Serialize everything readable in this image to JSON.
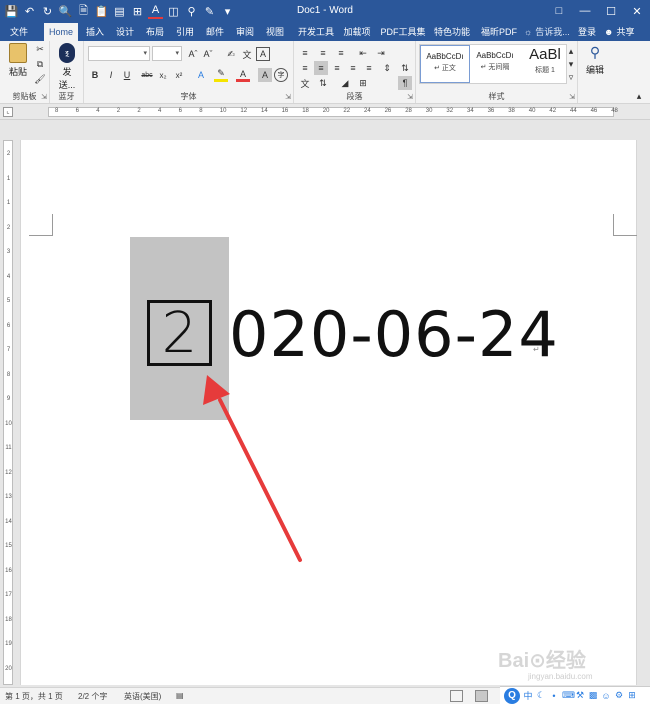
{
  "window": {
    "title": "Doc1 - Word",
    "controls": [
      "□",
      "—",
      "☐",
      "✕"
    ]
  },
  "qat": [
    "save-icon",
    "undo-icon",
    "redo-icon",
    "print-preview-icon",
    "new-icon",
    "paste-icon",
    "paragraph-icon",
    "insert-icon",
    "font-color-icon",
    "columns-icon",
    "find-icon",
    "touch-icon",
    "customize-icon"
  ],
  "tabs": [
    "文件",
    "Home",
    "插入",
    "设计",
    "布局",
    "引用",
    "邮件",
    "审阅",
    "视图",
    "开发工具",
    "加载项",
    "PDF工具集",
    "特色功能",
    "福昕PDF"
  ],
  "tell_me": "告诉我...",
  "login": "登录",
  "share": "共享",
  "ribbon": {
    "clipboard": {
      "label": "剪贴板",
      "paste": "粘贴"
    },
    "bluetooth": {
      "label": "蓝牙",
      "send_line1": "发",
      "send_line2": "送..."
    },
    "font": {
      "label": "字体",
      "font_name": "",
      "font_size": ""
    },
    "paragraph": {
      "label": "段落"
    },
    "styles": {
      "label": "样式",
      "items": [
        {
          "sample": "AaBbCcDı",
          "name": "↵ 正文"
        },
        {
          "sample": "AaBbCcDı",
          "name": "↵ 无间隔"
        },
        {
          "sample": "AaBl",
          "name": "标题 1"
        }
      ]
    },
    "editing": {
      "label": "编辑"
    }
  },
  "ruler": {
    "h_numbers": [
      "8",
      "6",
      "4",
      "2",
      "2",
      "4",
      "6",
      "8",
      "10",
      "12",
      "14",
      "16",
      "18",
      "20",
      "22",
      "24",
      "26",
      "28",
      "30",
      "32",
      "34",
      "36",
      "38",
      "40",
      "42",
      "44",
      "46",
      "48"
    ],
    "v_numbers": [
      "2",
      "1",
      "1",
      "2",
      "3",
      "4",
      "5",
      "6",
      "7",
      "8",
      "9",
      "10",
      "11",
      "12",
      "13",
      "14",
      "15",
      "16",
      "17",
      "18",
      "19",
      "20"
    ]
  },
  "document": {
    "enclosed_char": "2",
    "date_text": "020-06-24",
    "para_mark": "↵"
  },
  "status": {
    "page": "第 1 页，共 1 页",
    "words": "2/2 个字",
    "language": "英语(美国)"
  },
  "ime": {
    "logo": "Q",
    "mode": "中"
  },
  "watermark": {
    "text": "Bai⊙经验",
    "url": "jingyan.baidu.com"
  },
  "colors": {
    "accent": "#2b579a",
    "arrow": "#e63b3b",
    "selection": "#c3c3c3"
  }
}
